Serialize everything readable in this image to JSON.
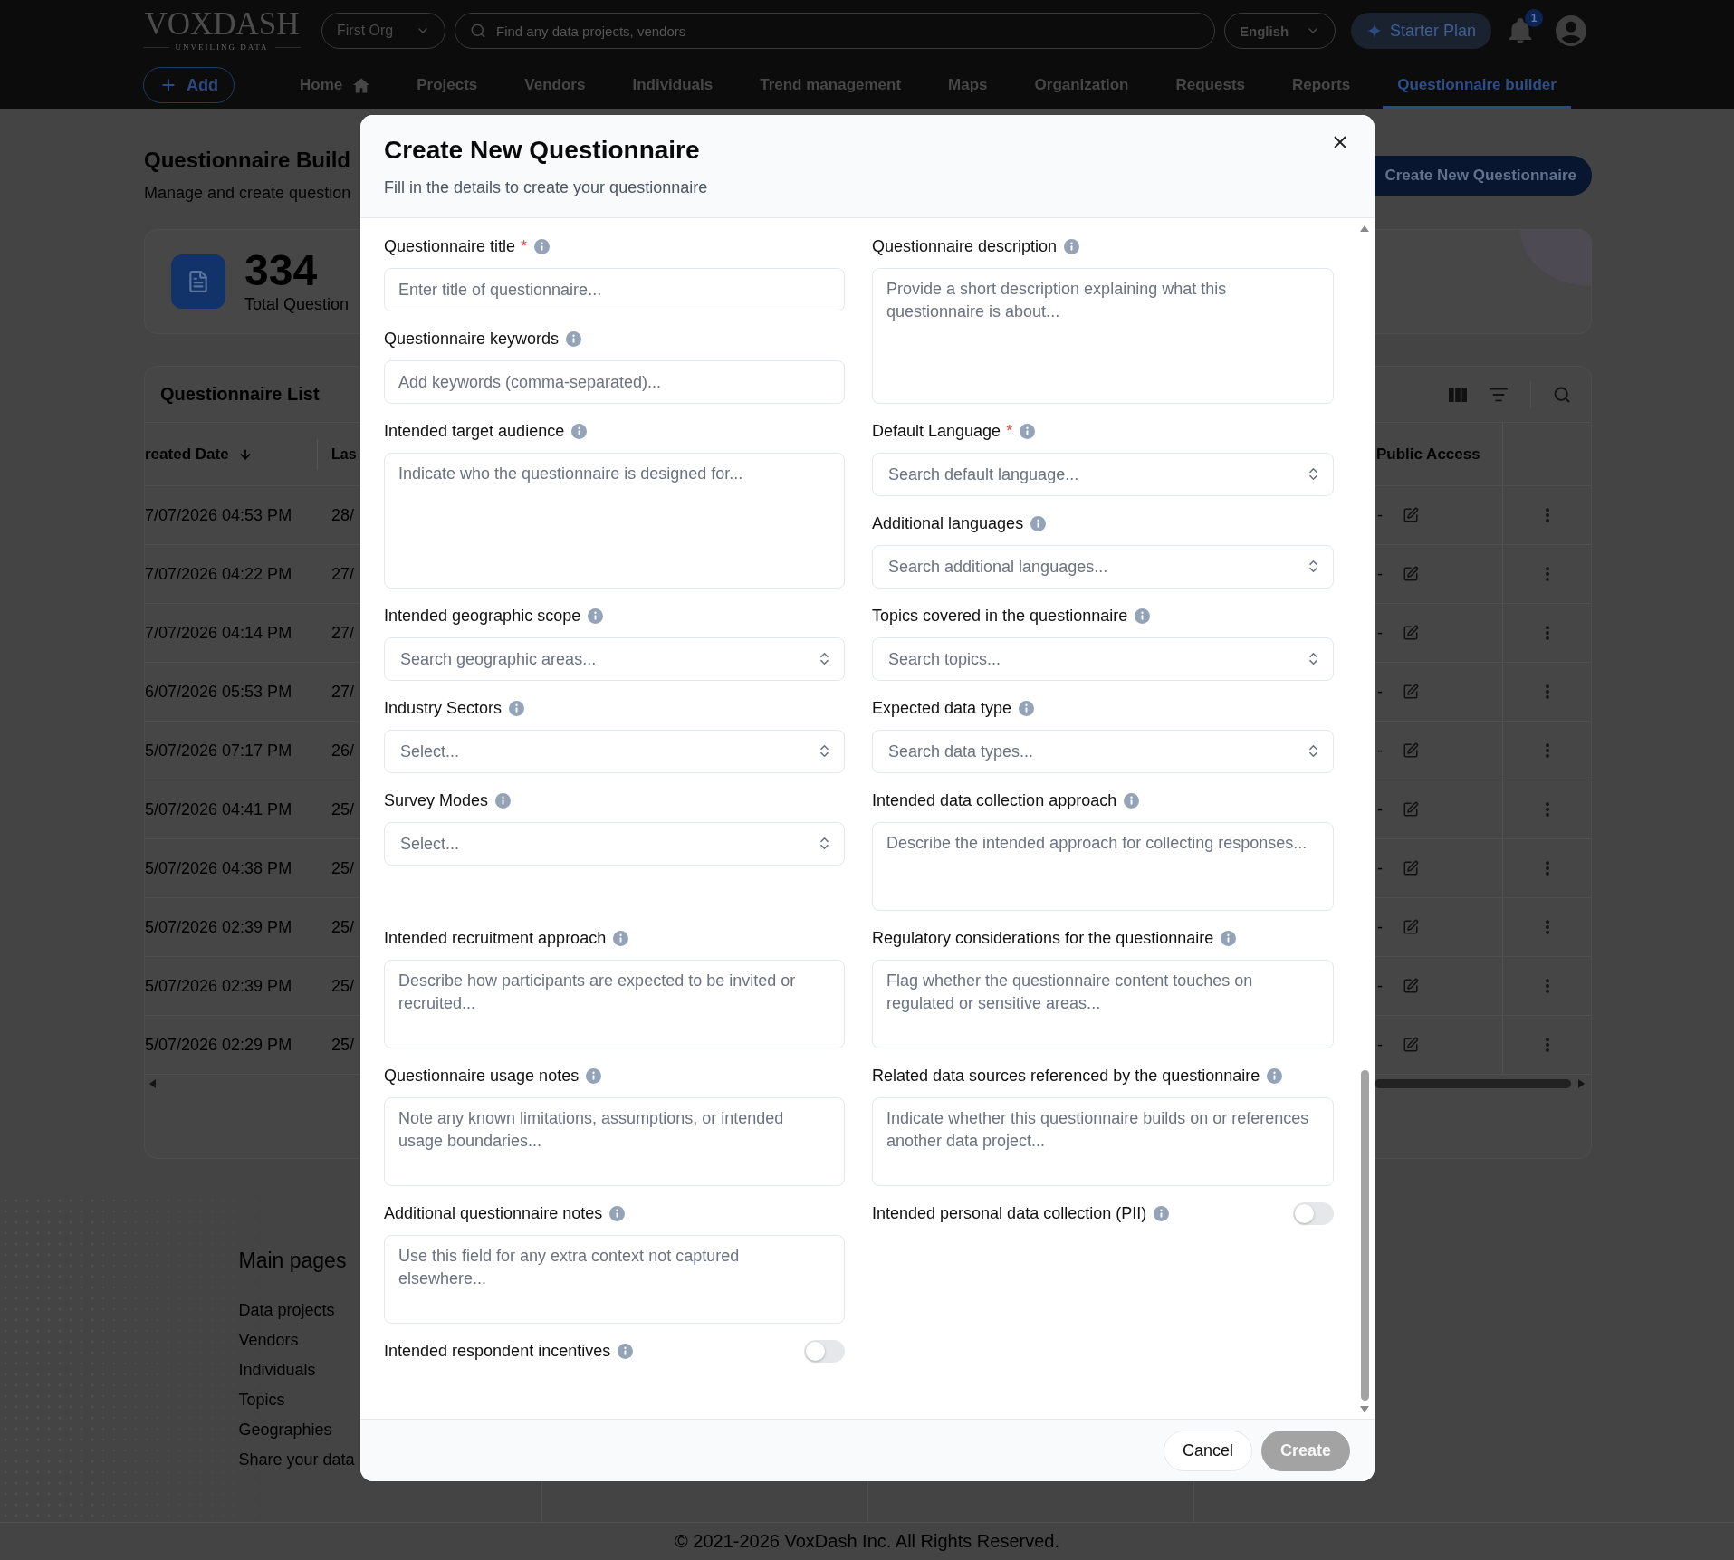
{
  "header": {
    "logo": "VOXDASH",
    "tagline": "UNVEILING DATA",
    "org_select": {
      "value": "First Org"
    },
    "search": {
      "placeholder": "Find any data projects, vendors"
    },
    "language_select": {
      "value": "English"
    },
    "plan_button": {
      "label": "Starter Plan"
    },
    "notifications": {
      "badge": "1"
    }
  },
  "nav": {
    "add_button": {
      "label": "Add"
    },
    "items": [
      {
        "label": "Home",
        "kind": "home",
        "selected": false
      },
      {
        "label": "Projects",
        "kind": "link",
        "selected": false
      },
      {
        "label": "Vendors",
        "kind": "link",
        "selected": false
      },
      {
        "label": "Individuals",
        "kind": "link",
        "selected": false
      },
      {
        "label": "Trend management",
        "kind": "link",
        "selected": false
      },
      {
        "label": "Maps",
        "kind": "link",
        "selected": false
      },
      {
        "label": "Organization",
        "kind": "link",
        "selected": false
      },
      {
        "label": "Requests",
        "kind": "link",
        "selected": false
      },
      {
        "label": "Reports",
        "kind": "link",
        "selected": false
      },
      {
        "label": "Questionnaire builder",
        "kind": "link",
        "selected": true
      }
    ]
  },
  "page": {
    "title": "Questionnaire Build",
    "subtitle": "Manage and create question",
    "create_button": {
      "label": "Create New Questionnaire"
    },
    "stats": {
      "value": "334",
      "label": "Total Question"
    }
  },
  "table": {
    "title": "Questionnaire List",
    "columns": [
      {
        "label": "reated Date",
        "sorted": true
      },
      {
        "label": "Las",
        "sorted": false
      },
      {
        "label": "Public Access",
        "sorted": false
      }
    ],
    "rows": [
      {
        "created_date": "7/07/2026 04:53 PM",
        "column_2": "28/",
        "column_3": "-"
      },
      {
        "created_date": "7/07/2026 04:22 PM",
        "column_2": "27/",
        "column_3": "-"
      },
      {
        "created_date": "7/07/2026 04:14 PM",
        "column_2": "27/",
        "column_3": "-"
      },
      {
        "created_date": "6/07/2026 05:53 PM",
        "column_2": "27/",
        "column_3": "-"
      },
      {
        "created_date": "5/07/2026 07:17 PM",
        "column_2": "26/",
        "column_3": "-"
      },
      {
        "created_date": "5/07/2026 04:41 PM",
        "column_2": "25/",
        "column_3": "-"
      },
      {
        "created_date": "5/07/2026 04:38 PM",
        "column_2": "25/",
        "column_3": "-"
      },
      {
        "created_date": "5/07/2026 02:39 PM",
        "column_2": "25/",
        "column_3": "-"
      },
      {
        "created_date": "5/07/2026 02:39 PM",
        "column_2": "25/",
        "column_3": "-"
      },
      {
        "created_date": "5/07/2026 02:29 PM",
        "column_2": "25/",
        "column_3": "-"
      }
    ]
  },
  "footer": {
    "heading": "Main pages",
    "links": [
      "Data projects",
      "Vendors",
      "Individuals",
      "Topics",
      "Geographies",
      "Share your data"
    ],
    "copyright": "© 2021-2026 VoxDash Inc. All Rights Reserved."
  },
  "modal": {
    "title": "Create New Questionnaire",
    "subtitle": "Fill in the details to create your questionnaire",
    "rows": [
      {
        "left": [
          {
            "kind": "text",
            "label": "Questionnaire title",
            "required_mark": "*",
            "placeholder": "Enter title of questionnaire..."
          },
          {
            "kind": "text",
            "label": "Questionnaire keywords",
            "placeholder": "Add keywords (comma-separated)..."
          }
        ],
        "right": [
          {
            "kind": "textarea",
            "label": "Questionnaire description",
            "placeholder": "Provide a short description explaining what this questionnaire is about..."
          }
        ]
      },
      {
        "left": [
          {
            "kind": "textarea",
            "label": "Intended target audience",
            "placeholder": "Indicate who the questionnaire is designed for..."
          }
        ],
        "right": [
          {
            "kind": "select",
            "label": "Default Language",
            "required_mark": "*",
            "placeholder": "Search default language..."
          },
          {
            "kind": "select",
            "label": "Additional languages",
            "placeholder": "Search additional languages..."
          }
        ]
      },
      {
        "left": [
          {
            "kind": "select",
            "label": "Intended geographic scope",
            "placeholder": "Search geographic areas..."
          }
        ],
        "right": [
          {
            "kind": "select",
            "label": "Topics covered in the questionnaire",
            "placeholder": "Search topics..."
          }
        ]
      },
      {
        "left": [
          {
            "kind": "select",
            "label": "Industry Sectors",
            "placeholder": "Select..."
          }
        ],
        "right": [
          {
            "kind": "select",
            "label": "Expected data type",
            "placeholder": "Search data types..."
          }
        ]
      },
      {
        "left": [
          {
            "kind": "select",
            "label": "Survey Modes",
            "placeholder": "Select..."
          }
        ],
        "right": [
          {
            "kind": "textarea",
            "label": "Intended data collection approach",
            "placeholder": "Describe the intended approach for collecting responses..."
          }
        ]
      },
      {
        "left": [
          {
            "kind": "textarea",
            "label": "Intended recruitment approach",
            "placeholder": "Describe how participants are expected to be invited or recruited..."
          }
        ],
        "right": [
          {
            "kind": "textarea",
            "label": "Regulatory considerations for the questionnaire",
            "placeholder": "Flag whether the questionnaire content touches on regulated or sensitive areas..."
          }
        ]
      },
      {
        "left": [
          {
            "kind": "textarea",
            "label": "Questionnaire usage notes",
            "placeholder": "Note any known limitations, assumptions, or intended usage boundaries..."
          }
        ],
        "right": [
          {
            "kind": "textarea",
            "label": "Related data sources referenced by the questionnaire",
            "placeholder": "Indicate whether this questionnaire builds on or references another data project..."
          }
        ]
      },
      {
        "left": [
          {
            "kind": "textarea",
            "label": "Additional questionnaire notes",
            "placeholder": "Use this field for any extra context not captured elsewhere..."
          }
        ],
        "right": [
          {
            "kind": "toggle",
            "label": "Intended personal data collection (PII)",
            "on": false
          }
        ]
      },
      {
        "left": [
          {
            "kind": "toggle",
            "label": "Intended respondent incentives",
            "on": false
          }
        ]
      }
    ],
    "buttons": [
      {
        "label": "Cancel",
        "kind": "secondary",
        "disabled": false
      },
      {
        "label": "Create",
        "kind": "primary",
        "disabled": true
      }
    ]
  }
}
